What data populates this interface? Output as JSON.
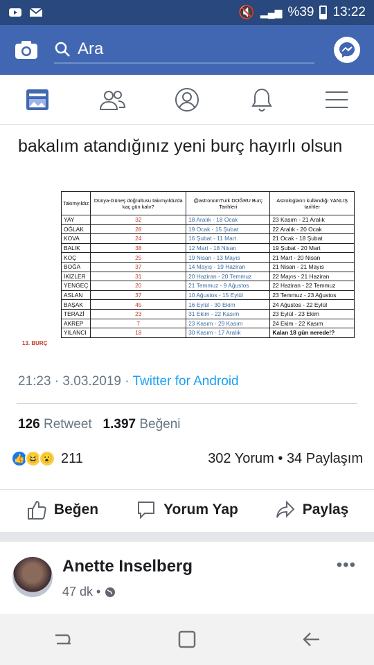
{
  "status_bar": {
    "battery": "%39",
    "time": "13:22"
  },
  "app_bar": {
    "search_placeholder": "Ara"
  },
  "tweet": {
    "text": "bakalım atandığınız yeni burç hayırlı olsun",
    "table": {
      "headers": [
        "Takımyıldız",
        "Dünya-Güneş doğrultusu takımyıldızda kaç gün kalır?",
        "@astronomTurk DOĞRU Burç Tarihleri",
        "Astrologların kullandığı YANLIŞ tarihler"
      ],
      "rows": [
        [
          "YAY",
          "32",
          "18 Aralık - 18 Ocak",
          "23 Kasım - 21 Aralık"
        ],
        [
          "OĞLAK",
          "28",
          "19 Ocak - 15 Şubat",
          "22 Aralık - 20 Ocak"
        ],
        [
          "KOVA",
          "24",
          "16 Şubat - 11 Mart",
          "21 Ocak - 18 Şubat"
        ],
        [
          "BALIK",
          "38",
          "12 Mart - 18 Nisan",
          "19 Şubat - 20 Mart"
        ],
        [
          "KOÇ",
          "25",
          "19 Nisan - 13 Mayıs",
          "21 Mart - 20 Nisan"
        ],
        [
          "BOĞA",
          "37",
          "14 Mayıs - 19 Haziran",
          "21 Nisan - 21 Mayıs"
        ],
        [
          "İKİZLER",
          "31",
          "20 Haziran - 20 Temmuz",
          "22 Mayıs - 21 Haziran"
        ],
        [
          "YENGEÇ",
          "20",
          "21 Temmuz - 9 Ağustos",
          "22 Haziran - 22 Temmuz"
        ],
        [
          "ASLAN",
          "37",
          "10 Ağustos - 15 Eylül",
          "23 Temmuz - 23 Ağustos"
        ],
        [
          "BAŞAK",
          "45",
          "16 Eylül - 30 Ekim",
          "24 Ağustos - 22 Eylül"
        ],
        [
          "TERAZİ",
          "23",
          "31 Ekim - 22 Kasım",
          "23 Eylül - 23 Ekim"
        ],
        [
          "AKREP",
          "7",
          "23 Kasım - 29 Kasım",
          "24 Ekim - 22 Kasım"
        ],
        [
          "YILANCI",
          "18",
          "30 Kasım - 17 Aralık",
          "Kalan 18 gün nerede!?"
        ]
      ],
      "burc13_label": "13. BURÇ"
    },
    "time": "21:23 · 3.03.2019 · ",
    "via": "Twitter for Android",
    "retweets": "126",
    "retweets_label": "Retweet",
    "likes": "1.397",
    "likes_label": "Beğeni"
  },
  "reactions": {
    "count": "211",
    "summary": "302 Yorum • 34 Paylaşım"
  },
  "actions": {
    "like": "Beğen",
    "comment": "Yorum Yap",
    "share": "Paylaş"
  },
  "next_post": {
    "author": "Anette Inselberg",
    "time": "47 dk •"
  }
}
